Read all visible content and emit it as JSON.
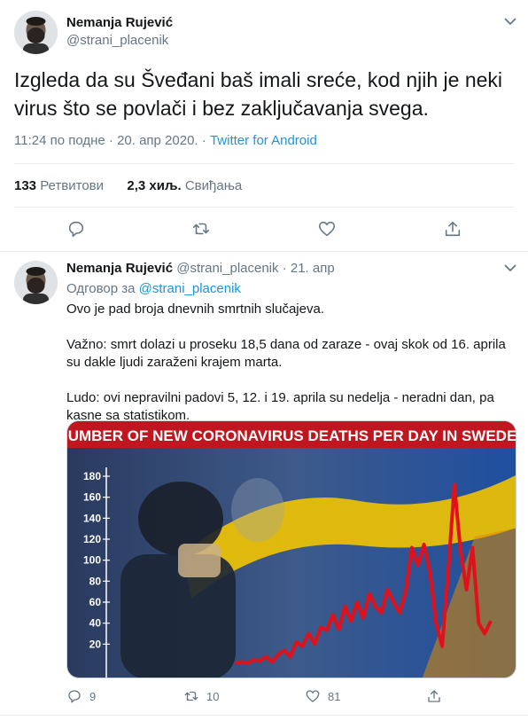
{
  "tweet": {
    "author_name": "Nemanja Rujević",
    "author_handle": "@strani_placenik",
    "text": "Izgleda da su Šveđani baš imali sreće, kod njih je neki virus što se povlači i bez zaključavanja svega.",
    "timestamp": "11:24 по подне · 20. апр 2020. · ",
    "source": "Twitter for Android",
    "retweets_count": "133",
    "retweets_label": "Ретвитови",
    "likes_count": "2,3 хиљ.",
    "likes_label": "Свиђања"
  },
  "reply": {
    "author_name": "Nemanja Rujević",
    "author_handle_date": "@strani_placenik · 21. апр",
    "reply_to_label": "Одговор за",
    "reply_to_handle": "@strani_placenik",
    "paragraphs": [
      "Ovo je pad broja dnevnih smrtnih slučajeva.",
      "Važno: smrt dolazi u proseku 18,5 dana od zaraze - ovaj skok od 16. aprila su dakle ljudi zaraženi krajem marta.",
      "Ludo: ovi nepravilni padovi 5, 12. i 19. aprila su nedelja - neradni dan, pa kasne sa statistikom."
    ],
    "image": {
      "headline": "NUMBER OF NEW CORONAVIRUS DEATHS PER DAY IN SWEDEN",
      "y_ticks": [
        "180",
        "160",
        "140",
        "120",
        "100",
        "80",
        "60",
        "40",
        "20"
      ],
      "series_values": [
        2,
        3,
        2,
        5,
        4,
        8,
        3,
        10,
        14,
        8,
        22,
        18,
        30,
        20,
        36,
        33,
        48,
        34,
        56,
        42,
        60,
        45,
        68,
        56,
        50,
        72,
        60,
        50,
        70,
        112,
        95,
        115,
        88,
        40,
        18,
        90,
        172,
        110,
        72,
        112,
        40,
        30,
        42
      ],
      "ylim": [
        0,
        180
      ]
    },
    "replies_count": "9",
    "retweets_count": "10",
    "likes_count": "81"
  },
  "colors": {
    "link": "#1b95e0",
    "muted": "#657786",
    "headline_bg": "#c0161f",
    "line": "#e0111b"
  },
  "icons": [
    "chevron-down-icon",
    "reply-icon",
    "retweet-icon",
    "heart-icon",
    "share-icon"
  ]
}
